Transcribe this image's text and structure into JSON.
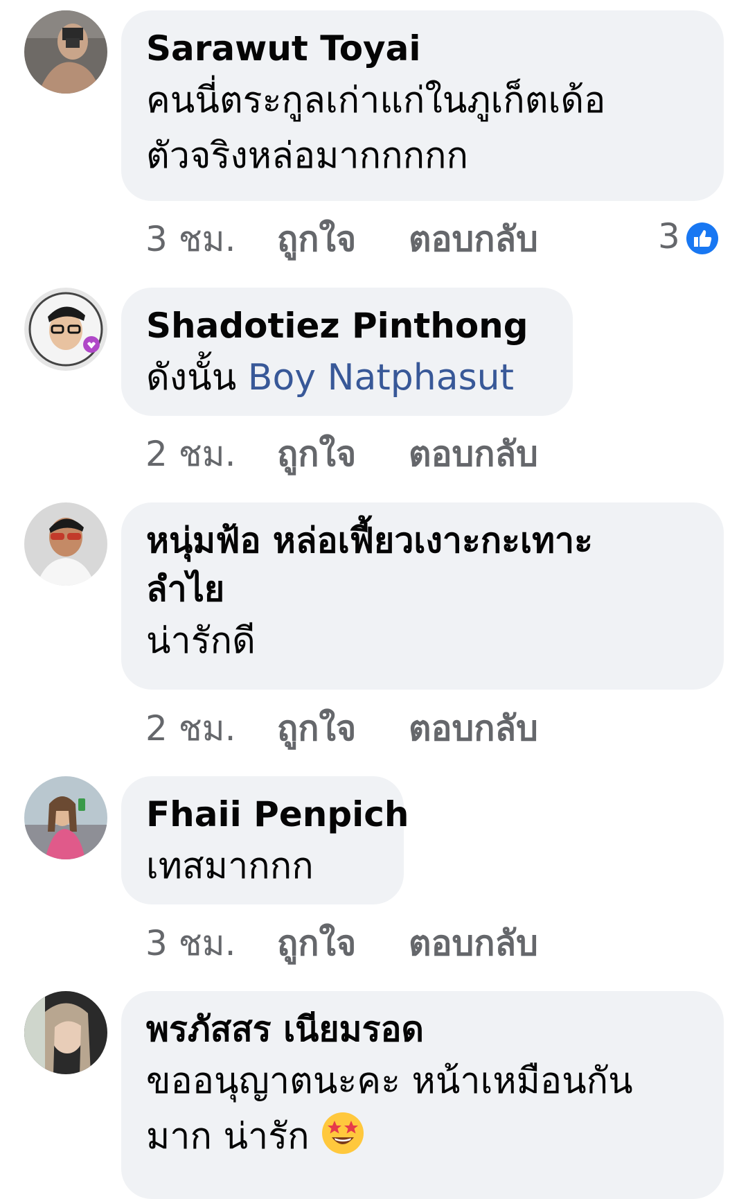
{
  "comments": [
    {
      "author": "Sarawut Toyai",
      "lines": [
        "คนนี่ตระกูลเก่าแก่ในภูเก็ตเด้อ",
        "ตัวจริงหล่อมากกกกก"
      ],
      "time": "3 ชม.",
      "like_label": "ถูกใจ",
      "reply_label": "ตอบกลับ",
      "reaction_count": "3"
    },
    {
      "author": "Shadotiez Pinthong",
      "text_prefix": "ดังนั้น ",
      "mention": "Boy Natphasut",
      "time": "2 ชม.",
      "like_label": "ถูกใจ",
      "reply_label": "ตอบกลับ"
    },
    {
      "author_lines": [
        "หนุ่มฟ้อ หล่อเฟี้ยวเงาะกะเทาะ",
        "ลำไย"
      ],
      "lines": [
        "น่ารักดี"
      ],
      "time": "2 ชม.",
      "like_label": "ถูกใจ",
      "reply_label": "ตอบกลับ"
    },
    {
      "author": "Fhaii Penpich",
      "lines": [
        "เทสมากกก"
      ],
      "time": "3 ชม.",
      "like_label": "ถูกใจ",
      "reply_label": "ตอบกลับ"
    },
    {
      "author": "พรภัสสร เนียมรอด",
      "lines": [
        "ขออนุญาตนะคะ หน้าเหมือนกัน",
        "มาก น่ารัก"
      ],
      "emoji": "star-struck-emoji"
    }
  ],
  "colors": {
    "bubble": "#f0f2f5",
    "meta_text": "#65676b",
    "mention": "#385898",
    "like_blue": "#1877f2"
  }
}
